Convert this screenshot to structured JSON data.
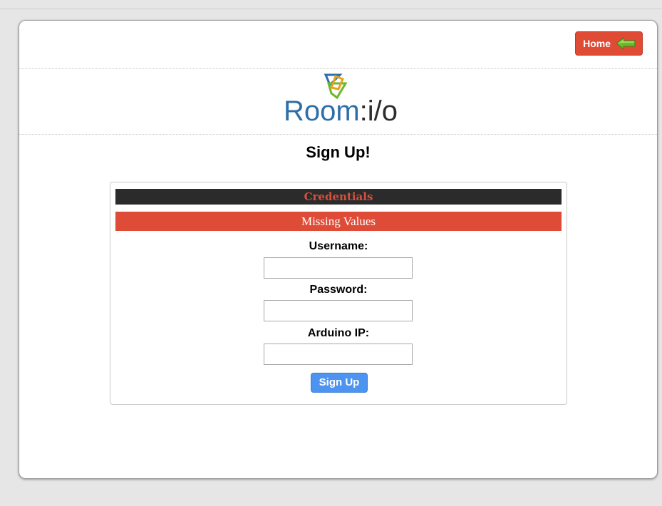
{
  "header": {
    "home_label": "Home"
  },
  "logo": {
    "text_room": "Room",
    "text_io": ":i/o"
  },
  "page": {
    "title": "Sign Up!"
  },
  "form": {
    "section_title": "Credentials",
    "error_message": "Missing Values",
    "fields": [
      {
        "label": "Username:",
        "value": "",
        "placeholder": ""
      },
      {
        "label": "Password:",
        "value": "",
        "placeholder": ""
      },
      {
        "label": "Arduino IP:",
        "value": "",
        "placeholder": ""
      }
    ],
    "submit_label": "Sign Up"
  },
  "icons": {
    "home_arrow": "arrow-left-icon",
    "logo_mark": "room-io-logo-mark"
  },
  "colors": {
    "page_background": "#e6e6e6",
    "home_button": "#e04b36",
    "section_header_bg": "#2b2b2b",
    "section_header_text": "#d8503d",
    "error_banner": "#de4c37",
    "submit_button": "#4d94f0",
    "logo_blue": "#2f6fa8",
    "logo_dark": "#2d2d2d",
    "arrow_green": "#6bb82d"
  }
}
